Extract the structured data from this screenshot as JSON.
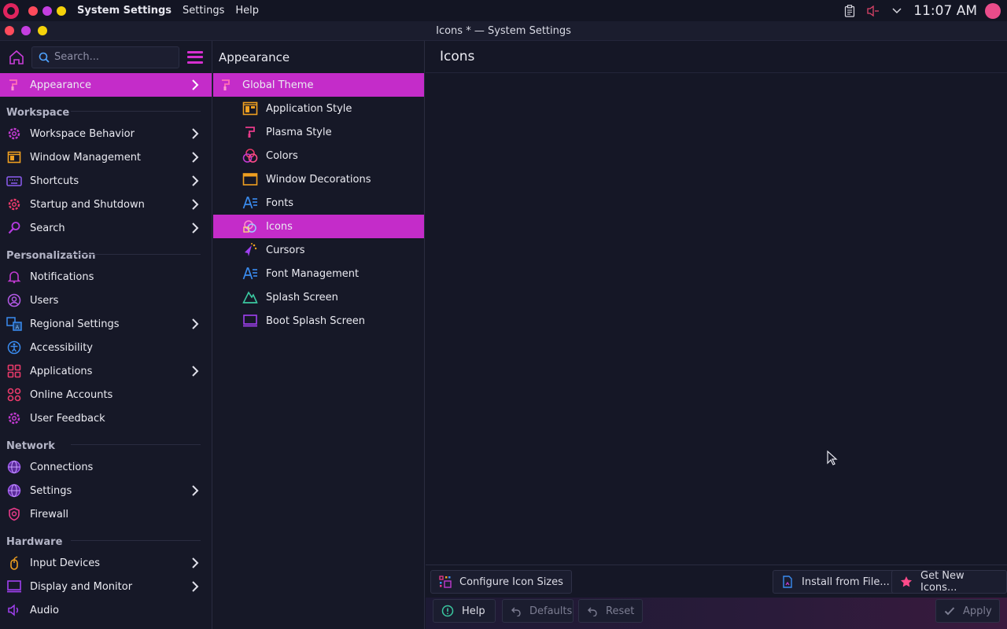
{
  "topbar": {
    "menu": [
      "System Settings",
      "Settings",
      "Help"
    ],
    "clock": "11:07 AM",
    "tray_icons": [
      "clipboard-icon",
      "volume-muted-icon",
      "chevron-down-icon"
    ]
  },
  "window": {
    "title": "Icons * — System Settings"
  },
  "sidebar": {
    "search_placeholder": "Search...",
    "active_item": "Appearance",
    "sections": {
      "workspace": "Workspace",
      "personalization": "Personalization",
      "network": "Network",
      "hardware": "Hardware"
    },
    "items": {
      "appearance": "Appearance",
      "workspace_behavior": "Workspace Behavior",
      "window_management": "Window Management",
      "shortcuts": "Shortcuts",
      "startup_shutdown": "Startup and Shutdown",
      "search": "Search",
      "notifications": "Notifications",
      "users": "Users",
      "regional_settings": "Regional Settings",
      "accessibility": "Accessibility",
      "applications": "Applications",
      "online_accounts": "Online Accounts",
      "user_feedback": "User Feedback",
      "connections": "Connections",
      "net_settings": "Settings",
      "firewall": "Firewall",
      "input_devices": "Input Devices",
      "display_monitor": "Display and Monitor",
      "audio": "Audio"
    }
  },
  "appearance_pane": {
    "title": "Appearance",
    "items": [
      "Global Theme",
      "Application Style",
      "Plasma Style",
      "Colors",
      "Window Decorations",
      "Fonts",
      "Icons",
      "Cursors",
      "Font Management",
      "Splash Screen",
      "Boot Splash Screen"
    ],
    "selected": "Icons"
  },
  "main": {
    "title": "Icons",
    "buttons": {
      "configure_sizes": "Configure Icon Sizes",
      "install_from_file": "Install from File...",
      "get_new": "Get New Icons...",
      "help": "Help",
      "defaults": "Defaults",
      "reset": "Reset",
      "apply": "Apply"
    }
  },
  "colors": {
    "accent": "#c42cc9",
    "background": "#151726",
    "sidebar": "#161827"
  }
}
